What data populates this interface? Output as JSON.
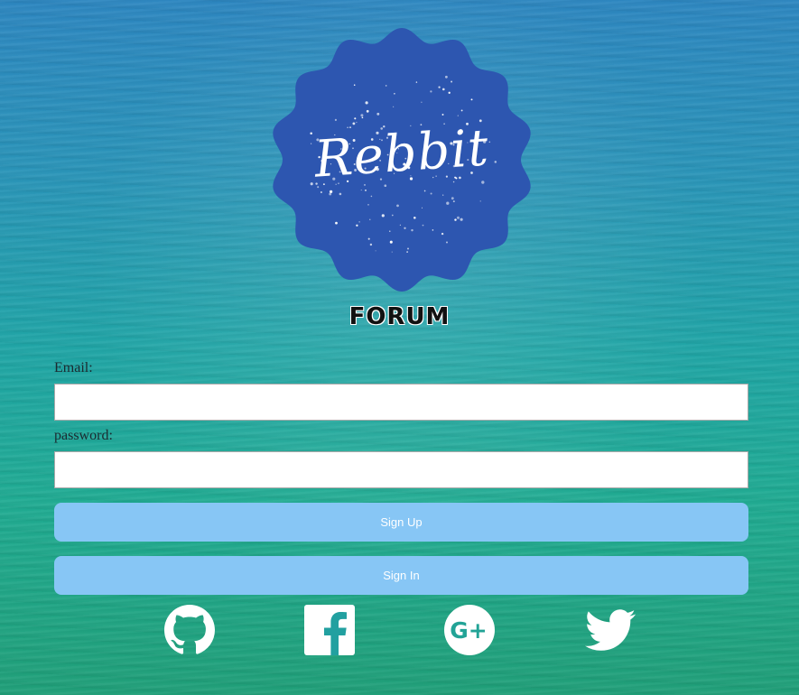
{
  "brand": {
    "logo_text": "Rebbit",
    "subtitle": "FORUM",
    "badge_color": "#2d56b0"
  },
  "form": {
    "email_label": "Email:",
    "email_value": "",
    "password_label": "password:",
    "password_value": "",
    "sign_up_label": "Sign Up",
    "sign_in_label": "Sign In",
    "button_color": "#87c6f5"
  },
  "social": [
    {
      "name": "github-icon"
    },
    {
      "name": "facebook-icon"
    },
    {
      "name": "google-plus-icon"
    },
    {
      "name": "twitter-icon"
    }
  ]
}
